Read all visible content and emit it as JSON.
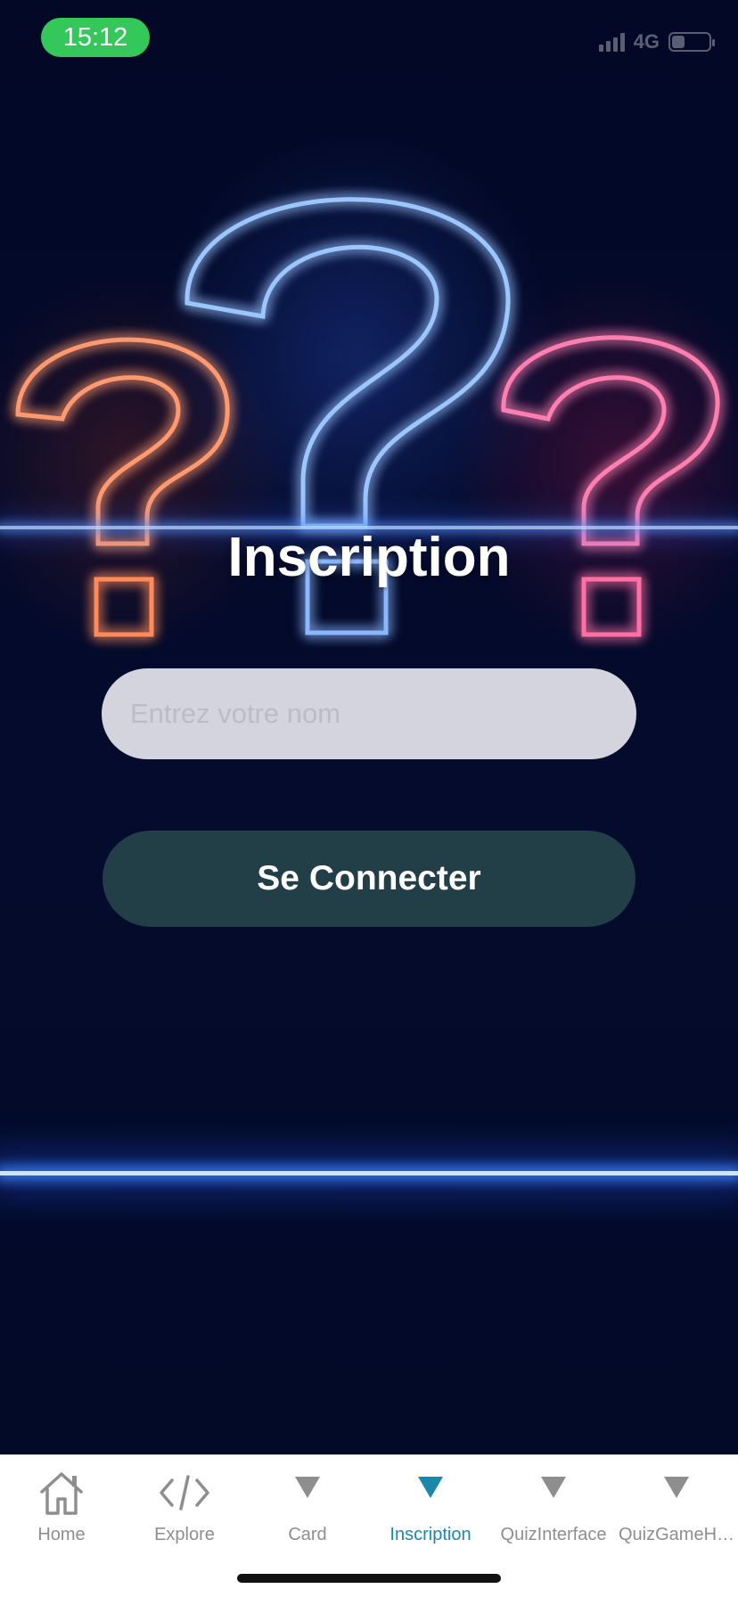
{
  "status_bar": {
    "time": "15:12",
    "network": "4G",
    "battery_level": 0.35
  },
  "page": {
    "title": "Inscription",
    "name_input": {
      "placeholder": "Entrez votre nom",
      "value": ""
    },
    "connect_button": "Se Connecter"
  },
  "tab_bar": {
    "active_index": 3,
    "active_color": "#1a88a8",
    "inactive_color": "#8e8e8e",
    "tabs": [
      {
        "label": "Home",
        "icon": "home-icon"
      },
      {
        "label": "Explore",
        "icon": "code-icon"
      },
      {
        "label": "Card",
        "icon": "triangle-down-icon"
      },
      {
        "label": "Inscription",
        "icon": "triangle-down-icon"
      },
      {
        "label": "QuizInterface",
        "icon": "triangle-down-icon"
      },
      {
        "label": "QuizGameH…",
        "icon": "triangle-down-icon"
      }
    ]
  },
  "colors": {
    "status_pill": "#34c759",
    "button_bg": "#223e47",
    "background": "#020a26"
  }
}
